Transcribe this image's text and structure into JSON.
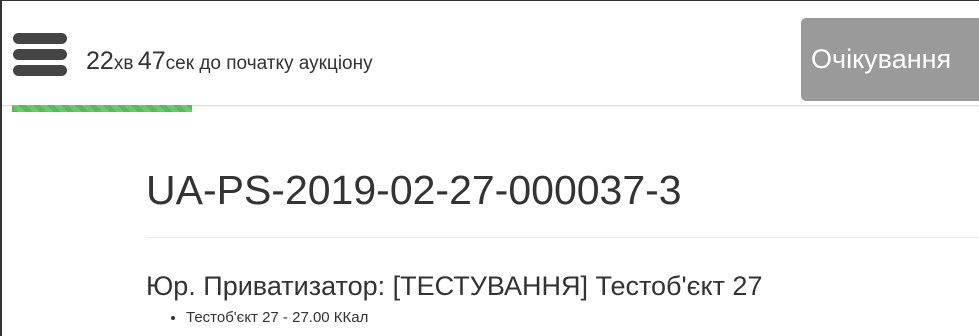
{
  "header": {
    "menu_icon": "hamburger-menu-icon",
    "countdown": {
      "minutes": "22",
      "minutes_unit": "хв",
      "seconds": "47",
      "seconds_unit": "сек",
      "suffix": " до початку аукціону"
    },
    "status_label": "Очікування"
  },
  "auction": {
    "id": "UA-PS-2019-02-27-000037-3",
    "organizer_title": "Юр. Приватизатор: [ТЕСТУВАННЯ] Тестоб'єкт 27",
    "items": [
      {
        "label": "Тестоб'єкт 27 - 27.00 ККал"
      }
    ]
  },
  "colors": {
    "progress": "#5cb85c",
    "status_button": "#9a9a9a",
    "text": "#333333"
  }
}
